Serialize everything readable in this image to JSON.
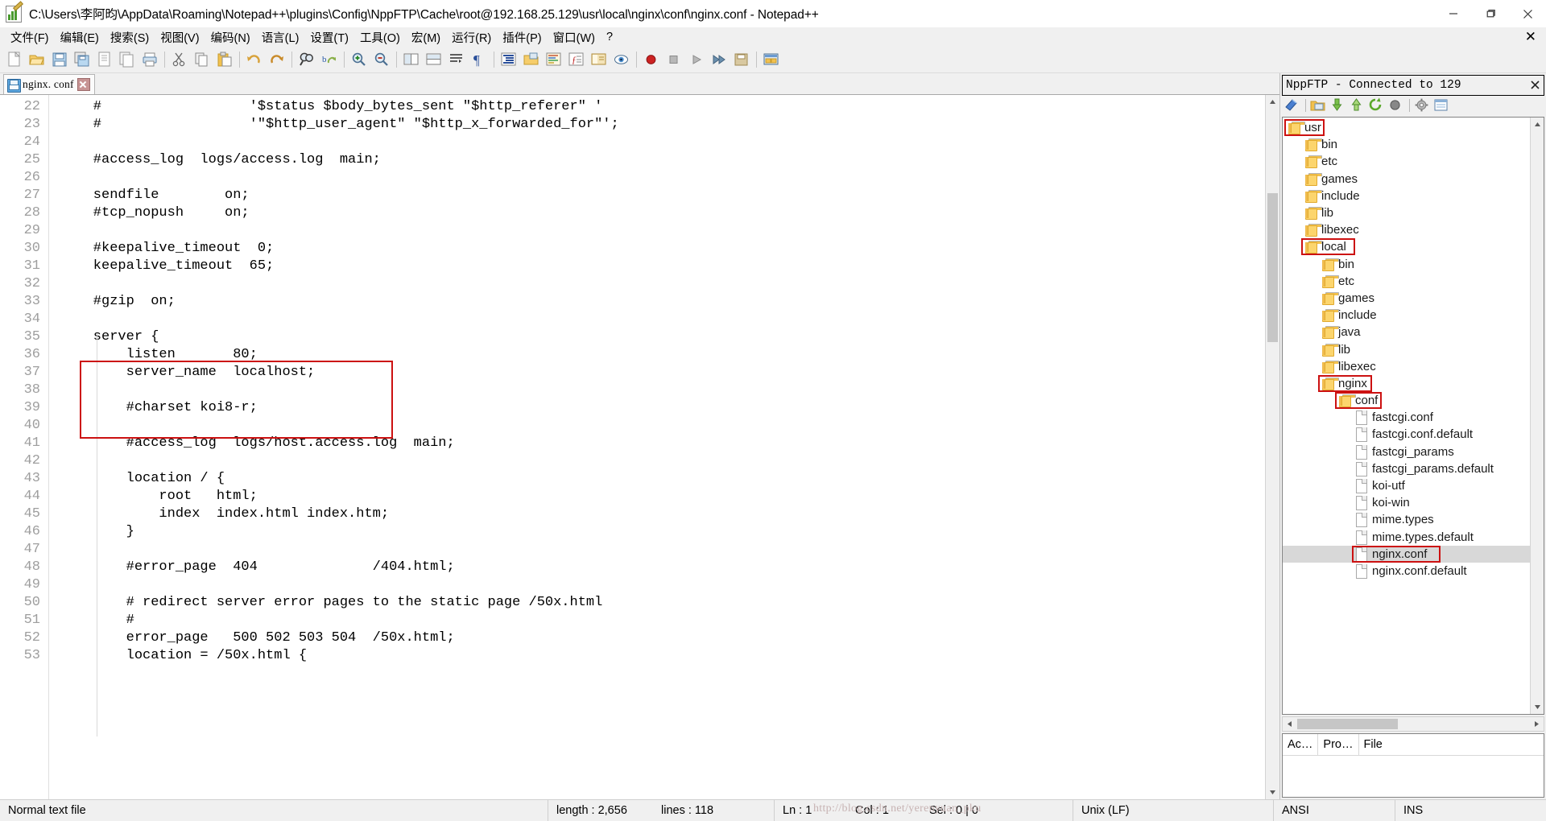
{
  "window": {
    "title": "C:\\Users\\李阿昀\\AppData\\Roaming\\Notepad++\\plugins\\Config\\NppFTP\\Cache\\root@192.168.25.129\\usr\\local\\nginx\\conf\\nginx.conf - Notepad++",
    "icon": "notepad-plus-plus-icon",
    "minimize_label": "—",
    "maximize_label": "▢",
    "close_label": "✕"
  },
  "menu": {
    "items": [
      "文件(F)",
      "编辑(E)",
      "搜索(S)",
      "视图(V)",
      "编码(N)",
      "语言(L)",
      "设置(T)",
      "工具(O)",
      "宏(M)",
      "运行(R)",
      "插件(P)",
      "窗口(W)",
      "?"
    ],
    "doc_close_label": "✕"
  },
  "toolbar": {
    "buttons": [
      "new-file-icon",
      "open-file-icon",
      "save-icon",
      "save-all-icon",
      "close-file-icon",
      "close-all-icon",
      "print-icon",
      "sep",
      "cut-icon",
      "copy-icon",
      "paste-icon",
      "sep",
      "undo-icon",
      "redo-icon",
      "sep",
      "find-icon",
      "replace-icon",
      "sep",
      "zoom-in-icon",
      "zoom-out-icon",
      "sep",
      "sync-vertical-icon",
      "sync-horizontal-icon",
      "word-wrap-icon",
      "show-all-chars-icon",
      "sep",
      "indent-guide-icon",
      "user-language-icon",
      "doc-map-icon",
      "function-list-icon",
      "folder-workspace-icon",
      "monitoring-icon",
      "sep",
      "macro-record-icon",
      "macro-stop-icon",
      "macro-play-icon",
      "macro-playall-icon",
      "macro-save-icon",
      "sep",
      "ftp-icon"
    ]
  },
  "tab": {
    "icon": "saved-file-icon",
    "label": "nginx. conf",
    "close_label": "✕"
  },
  "editor": {
    "first_line_number": 22,
    "lines": [
      {
        "n": 22,
        "text": "    #                  '$status $body_bytes_sent \"$http_referer\" '"
      },
      {
        "n": 23,
        "text": "    #                  '\"$http_user_agent\" \"$http_x_forwarded_for\"';"
      },
      {
        "n": 24,
        "text": ""
      },
      {
        "n": 25,
        "text": "    #access_log  logs/access.log  main;"
      },
      {
        "n": 26,
        "text": ""
      },
      {
        "n": 27,
        "text": "    sendfile        on;"
      },
      {
        "n": 28,
        "text": "    #tcp_nopush     on;"
      },
      {
        "n": 29,
        "text": ""
      },
      {
        "n": 30,
        "text": "    #keepalive_timeout  0;"
      },
      {
        "n": 31,
        "text": "    keepalive_timeout  65;"
      },
      {
        "n": 32,
        "text": ""
      },
      {
        "n": 33,
        "text": "    #gzip  on;"
      },
      {
        "n": 34,
        "text": ""
      },
      {
        "n": 35,
        "text": "    server {"
      },
      {
        "n": 36,
        "text": "        listen       80;"
      },
      {
        "n": 37,
        "text": "        server_name  localhost;"
      },
      {
        "n": 38,
        "text": ""
      },
      {
        "n": 39,
        "text": "        #charset koi8-r;"
      },
      {
        "n": 40,
        "text": ""
      },
      {
        "n": 41,
        "text": "        #access_log  logs/host.access.log  main;"
      },
      {
        "n": 42,
        "text": ""
      },
      {
        "n": 43,
        "text": "        location / {"
      },
      {
        "n": 44,
        "text": "            root   html;"
      },
      {
        "n": 45,
        "text": "            index  index.html index.htm;"
      },
      {
        "n": 46,
        "text": "        }"
      },
      {
        "n": 47,
        "text": ""
      },
      {
        "n": 48,
        "text": "        #error_page  404              /404.html;"
      },
      {
        "n": 49,
        "text": ""
      },
      {
        "n": 50,
        "text": "        # redirect server error pages to the static page /50x.html"
      },
      {
        "n": 51,
        "text": "        #"
      },
      {
        "n": 52,
        "text": "        error_page   500 502 503 504  /50x.html;"
      },
      {
        "n": 53,
        "text": "        location = /50x.html {"
      }
    ],
    "highlight_color": "#cc1111",
    "scroll": {
      "up_arrow": "▲",
      "down_arrow": "▼"
    }
  },
  "ftp": {
    "panel_title": "NppFTP - Connected to 129",
    "close_label": "✕",
    "toolbar_buttons": [
      "connect-icon",
      "sep",
      "open-dir-icon",
      "download-icon",
      "upload-icon",
      "refresh-icon",
      "abort-icon",
      "sep",
      "settings-icon",
      "messages-icon"
    ],
    "tree": [
      {
        "label": "usr",
        "type": "folder",
        "depth": 0,
        "boxed": true,
        "selected": false
      },
      {
        "label": "bin",
        "type": "folder",
        "depth": 1,
        "boxed": false,
        "selected": false
      },
      {
        "label": "etc",
        "type": "folder",
        "depth": 1,
        "boxed": false,
        "selected": false
      },
      {
        "label": "games",
        "type": "folder",
        "depth": 1,
        "boxed": false,
        "selected": false
      },
      {
        "label": "include",
        "type": "folder",
        "depth": 1,
        "boxed": false,
        "selected": false
      },
      {
        "label": "lib",
        "type": "folder",
        "depth": 1,
        "boxed": false,
        "selected": false
      },
      {
        "label": "libexec",
        "type": "folder",
        "depth": 1,
        "boxed": false,
        "selected": false
      },
      {
        "label": "local",
        "type": "folder",
        "depth": 1,
        "boxed": true,
        "selected": false
      },
      {
        "label": "bin",
        "type": "folder",
        "depth": 2,
        "boxed": false,
        "selected": false
      },
      {
        "label": "etc",
        "type": "folder",
        "depth": 2,
        "boxed": false,
        "selected": false
      },
      {
        "label": "games",
        "type": "folder",
        "depth": 2,
        "boxed": false,
        "selected": false
      },
      {
        "label": "include",
        "type": "folder",
        "depth": 2,
        "boxed": false,
        "selected": false
      },
      {
        "label": "java",
        "type": "folder",
        "depth": 2,
        "boxed": false,
        "selected": false
      },
      {
        "label": "lib",
        "type": "folder",
        "depth": 2,
        "boxed": false,
        "selected": false
      },
      {
        "label": "libexec",
        "type": "folder",
        "depth": 2,
        "boxed": false,
        "selected": false
      },
      {
        "label": "nginx",
        "type": "folder",
        "depth": 2,
        "boxed": true,
        "selected": false
      },
      {
        "label": "conf",
        "type": "folder",
        "depth": 3,
        "boxed": true,
        "selected": false
      },
      {
        "label": "fastcgi.conf",
        "type": "file",
        "depth": 4,
        "boxed": false,
        "selected": false
      },
      {
        "label": "fastcgi.conf.default",
        "type": "file",
        "depth": 4,
        "boxed": false,
        "selected": false
      },
      {
        "label": "fastcgi_params",
        "type": "file",
        "depth": 4,
        "boxed": false,
        "selected": false
      },
      {
        "label": "fastcgi_params.default",
        "type": "file",
        "depth": 4,
        "boxed": false,
        "selected": false
      },
      {
        "label": "koi-utf",
        "type": "file",
        "depth": 4,
        "boxed": false,
        "selected": false
      },
      {
        "label": "koi-win",
        "type": "file",
        "depth": 4,
        "boxed": false,
        "selected": false
      },
      {
        "label": "mime.types",
        "type": "file",
        "depth": 4,
        "boxed": false,
        "selected": false
      },
      {
        "label": "mime.types.default",
        "type": "file",
        "depth": 4,
        "boxed": false,
        "selected": false
      },
      {
        "label": "nginx.conf",
        "type": "file",
        "depth": 4,
        "boxed": true,
        "selected": true
      },
      {
        "label": "nginx.conf.default",
        "type": "file",
        "depth": 4,
        "boxed": false,
        "selected": false
      }
    ],
    "hscroll": {
      "left_arrow": "◄",
      "right_arrow": "►"
    },
    "vscroll": {
      "up_arrow": "▲",
      "down_arrow": "▼"
    },
    "queue_columns": [
      "Ac…",
      "Pro…",
      "File"
    ]
  },
  "statusbar": {
    "file_type": "Normal text file",
    "length": "length : 2,656",
    "lines": "lines : 118",
    "ln": "Ln : 1",
    "col": "Col : 1",
    "sel": "Sel : 0 | 0",
    "eol": "Unix (LF)",
    "encoding": "ANSI",
    "insert_mode": "INS",
    "watermark": "http://blog.csdn.net/yerenyuan_pku"
  }
}
